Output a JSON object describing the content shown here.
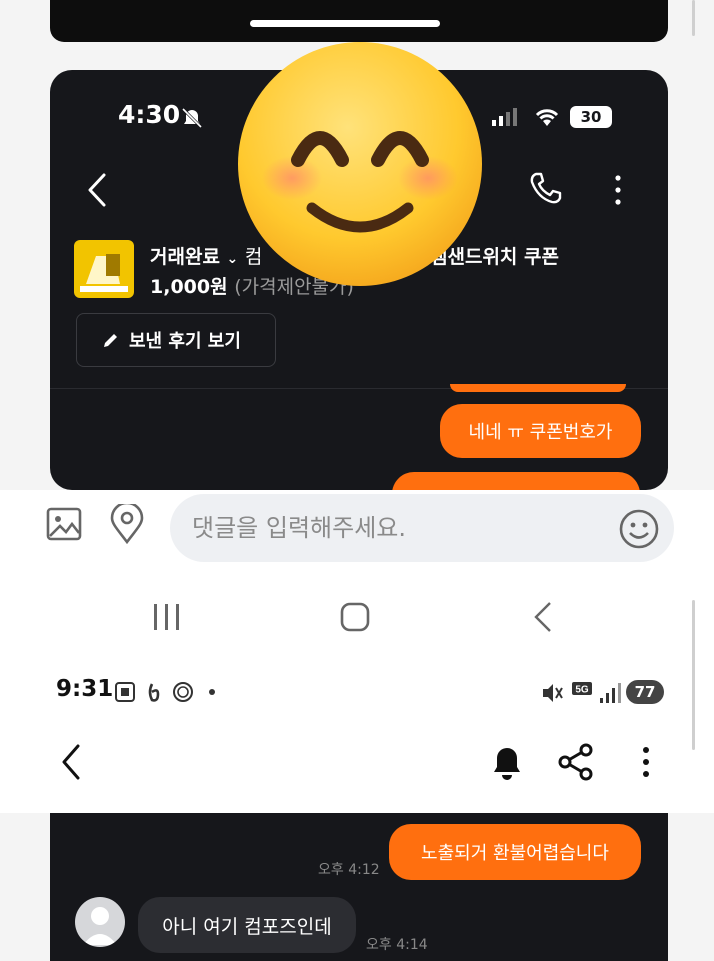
{
  "top_phone": {
    "status": {
      "time": "4:30",
      "battery": "30"
    },
    "product": {
      "status_label": "거래완료",
      "title_visible_left": "컴",
      "title_visible_right": "램샌드위치 쿠폰",
      "price": "1,000원",
      "price_note": "(가격제안불가)"
    },
    "review_button_label": "보낸 후기 보기",
    "messages": [
      {
        "text": "네네 ㅠ 쿠폰번호가"
      }
    ],
    "input_placeholder": "댓글을 입력해주세요."
  },
  "bottom_phone": {
    "status": {
      "time": "9:31",
      "network": "5G",
      "battery": "77"
    },
    "messages": [
      {
        "text": "노출되거 환불어렵습니다",
        "time": "오후 4:12"
      },
      {
        "text": "아니 여기 컴포즈인데",
        "time": "오후 4:14"
      }
    ]
  },
  "overlay_emoji": "smiling-face-with-smiling-eyes",
  "colors": {
    "accent": "#ff6f0f",
    "dark_bg": "#16171b"
  }
}
